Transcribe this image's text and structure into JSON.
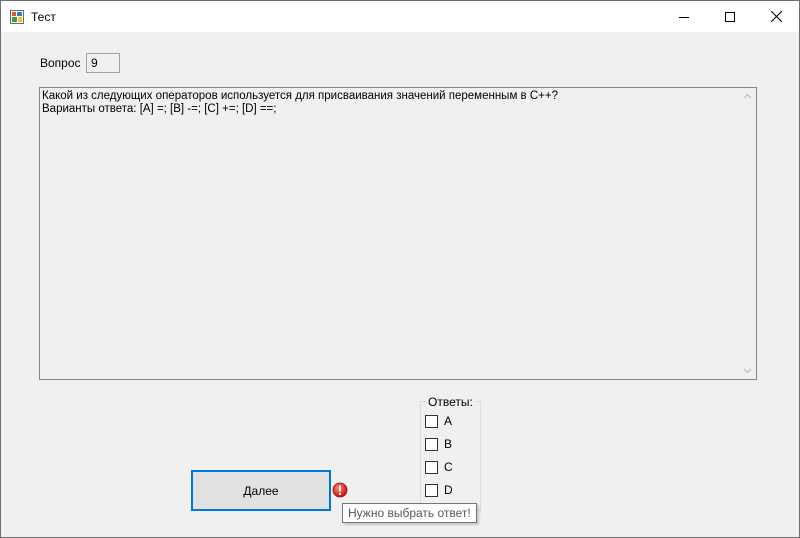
{
  "window": {
    "title": "Тест",
    "icon": "winforms-app-icon",
    "controls": [
      "minimize-icon",
      "maximize-icon",
      "close-icon"
    ]
  },
  "question": {
    "label": "Вопрос",
    "number": "9",
    "text": "Какой из следующих операторов используется для присваивания значений переменным в С++?\nВарианты ответа: [A] =; [B] -=; [C] +=; [D] ==;"
  },
  "answers": {
    "title": "Ответы:",
    "options": [
      {
        "label": "A",
        "checked": false
      },
      {
        "label": "B",
        "checked": false
      },
      {
        "label": "C",
        "checked": false
      },
      {
        "label": "D",
        "checked": false
      }
    ]
  },
  "next_button": {
    "label": "Далее"
  },
  "error": {
    "icon": "error-icon",
    "message": "Нужно выбрать ответ!",
    "color": "#e81123"
  },
  "colors": {
    "accent": "#0078d7",
    "background": "#f0f0f0"
  }
}
